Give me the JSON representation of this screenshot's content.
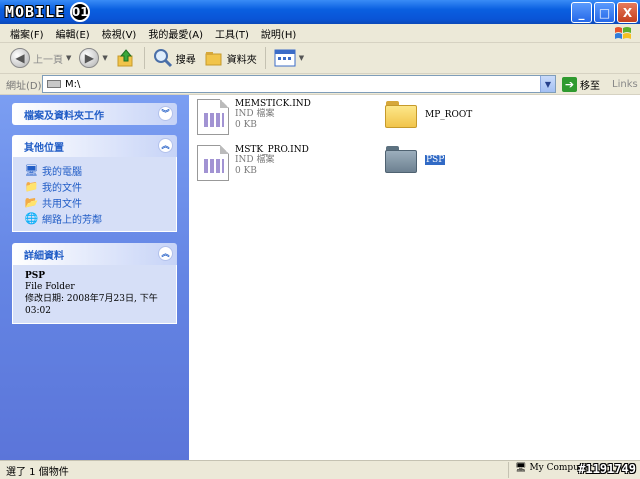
{
  "window": {
    "logo_text": "MOBILE",
    "logo_mark": "01",
    "buttons": {
      "minimize": "_",
      "maximize": "□",
      "close": "X"
    }
  },
  "menu": [
    "檔案(F)",
    "編輯(E)",
    "檢視(V)",
    "我的最愛(A)",
    "工具(T)",
    "說明(H)"
  ],
  "toolbar": {
    "back": "上一頁",
    "search": "搜尋",
    "folders": "資料夾"
  },
  "address": {
    "label": "網址(D)",
    "value": "M:\\",
    "go": "移至",
    "links": "Links"
  },
  "sidebar": {
    "tasks_title": "檔案及資料夾工作",
    "other_title": "其他位置",
    "places": [
      "我的電腦",
      "我的文件",
      "共用文件",
      "網路上的芳鄰"
    ],
    "details_title": "詳細資料",
    "details": {
      "name": "PSP",
      "type": "File Folder",
      "modified_1": "修改日期: 2008年7月23日, 下午",
      "modified_2": "03:02"
    }
  },
  "files": [
    {
      "name": "MEMSTICK.IND",
      "type": "IND 檔案",
      "size": "0 KB"
    },
    {
      "name": "MSTK_PRO.IND",
      "type": "IND 檔案",
      "size": "0 KB"
    }
  ],
  "folders": [
    {
      "name": "MP_ROOT",
      "color": "yellow"
    },
    {
      "name": "PSP",
      "color": "gray",
      "selected": true
    }
  ],
  "status": {
    "left": "選了 1 個物件",
    "right": "My Computer",
    "watermark": "#1191749"
  },
  "colors": {
    "titlebar": "#0a5fe0",
    "sidebar": "#6485e4",
    "link": "#215dc6",
    "selection": "#316ac5"
  }
}
